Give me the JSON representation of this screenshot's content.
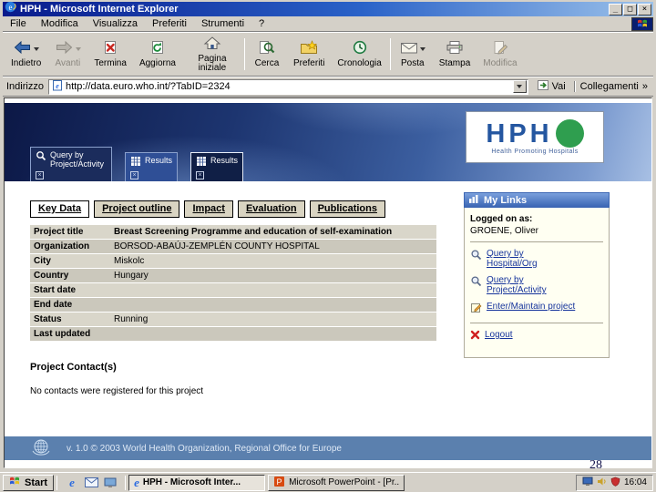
{
  "window": {
    "title": "HPH - Microsoft Internet Explorer",
    "controls": {
      "minimize": "_",
      "maximize": "□",
      "close": "×"
    },
    "menu": [
      "File",
      "Modifica",
      "Visualizza",
      "Preferiti",
      "Strumenti",
      "?"
    ],
    "toolbar": [
      {
        "label": "Indietro"
      },
      {
        "label": "Avanti"
      },
      {
        "label": "Termina"
      },
      {
        "label": "Aggiorna"
      },
      {
        "label": "Pagina iniziale"
      },
      {
        "label": "Cerca"
      },
      {
        "label": "Preferiti"
      },
      {
        "label": "Cronologia"
      },
      {
        "label": "Posta"
      },
      {
        "label": "Stampa"
      },
      {
        "label": "Modifica"
      }
    ],
    "address": {
      "label": "Indirizzo",
      "url": "http://data.euro.who.int/?TabID=2324",
      "go_label": "Vai",
      "links_label": "Collegamenti",
      "links_chevron": "»"
    }
  },
  "page": {
    "logo": {
      "text": "HPH",
      "caption": "Health Promoting Hospitals"
    },
    "nav_tabs": [
      {
        "label": "Query by Project/Activity"
      },
      {
        "label": "Results"
      },
      {
        "label": "Results"
      }
    ],
    "tabs": [
      {
        "label": "Key Data"
      },
      {
        "label": "Project outline"
      },
      {
        "label": "Impact"
      },
      {
        "label": "Evaluation"
      },
      {
        "label": "Publications"
      }
    ],
    "fields": [
      {
        "label": "Project title",
        "value": "Breast Screening Programme and education of self-examination"
      },
      {
        "label": "Organization",
        "value": "BORSOD-ABAÚJ-ZEMPLÉN COUNTY HOSPITAL"
      },
      {
        "label": "City",
        "value": "Miskolc"
      },
      {
        "label": "Country",
        "value": "Hungary"
      },
      {
        "label": "Start date",
        "value": ""
      },
      {
        "label": "End date",
        "value": ""
      },
      {
        "label": "Status",
        "value": "Running"
      },
      {
        "label": "Last updated",
        "value": ""
      }
    ],
    "contacts": {
      "heading": "Project Contact(s)",
      "empty_text": "No contacts were registered for this project"
    },
    "sidebar": {
      "title": "My Links",
      "logged_on_label": "Logged on as:",
      "user": "GROENE, Oliver",
      "links": [
        {
          "label": "Query by Hospital/Org"
        },
        {
          "label": "Query by Project/Activity"
        },
        {
          "label": "Enter/Maintain project"
        },
        {
          "label": "Logout"
        }
      ]
    },
    "footer": "v. 1.0 © 2003 World Health Organization, Regional Office for Europe"
  },
  "taskbar": {
    "start_label": "Start",
    "tasks": [
      {
        "label": "HPH - Microsoft Inter..."
      },
      {
        "label": "Microsoft PowerPoint - [Pr..."
      }
    ],
    "clock": "16:04"
  },
  "overlay": {
    "slide_number": "28"
  },
  "colors": {
    "titlebar_gradient_start": "#081a8c",
    "titlebar_gradient_end": "#9cc2ea",
    "banner_navy": "#1d3570",
    "logo_blue": "#2456a0",
    "logo_green": "#2f9e4f",
    "link_blue": "#16349c",
    "sidebar_ivory": "#fffff2",
    "footer_blue": "#5b80ae",
    "chrome_gray": "#d4d0c8"
  }
}
